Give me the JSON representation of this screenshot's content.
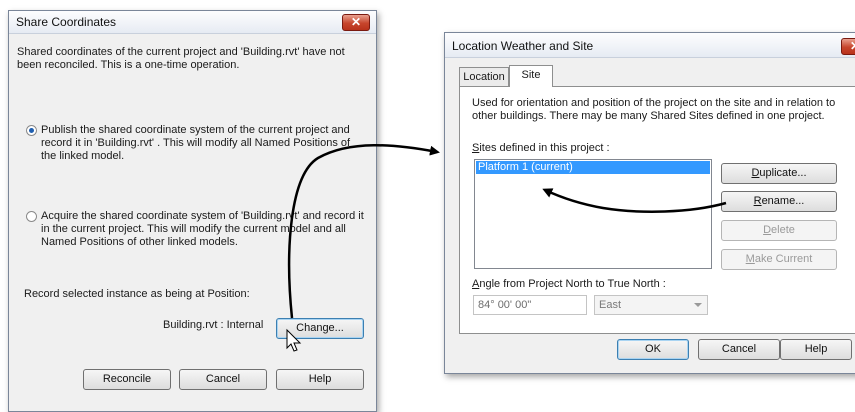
{
  "share_dialog": {
    "title": "Share Coordinates",
    "close_glyph": "✕",
    "intro": "Shared coordinates of the current project and 'Building.rvt' have not been reconciled. This is a one-time operation.",
    "option_publish": "Publish the shared coordinate system of the current project and record it in 'Building.rvt' . This will modify all Named Positions of the linked model.",
    "option_acquire": "Acquire the shared coordinate system of 'Building.rvt' and record it in the current project. This will modify the current model and all Named Positions of other linked models.",
    "selected_option": "publish",
    "record_label": "Record selected instance as being at Position:",
    "position_value": "Building.rvt : Internal",
    "change_button": "Change...",
    "reconcile_button": "Reconcile",
    "cancel_button": "Cancel",
    "help_button": "Help"
  },
  "location_dialog": {
    "title": "Location Weather and Site",
    "close_glyph": "✕",
    "tabs": [
      {
        "label": "Location",
        "active": false
      },
      {
        "label": "Site",
        "active": true
      }
    ],
    "description": "Used for orientation and position of the project on the site and in relation to other buildings. There may be many Shared Sites defined in one project.",
    "sites_label_prefix": "S",
    "sites_label_rest": "ites defined in this project :",
    "sites": [
      "Platform 1 (current)"
    ],
    "buttons": {
      "duplicate_prefix": "D",
      "duplicate_rest": "uplicate...",
      "rename_prefix": "R",
      "rename_rest": "ename...",
      "delete_prefix": "D",
      "delete_rest": "elete",
      "make_current_prefix": "M",
      "make_current_rest": "ake Current"
    },
    "angle_label_prefix": "A",
    "angle_label_rest": "ngle from Project North to True North :",
    "angle_value": "84° 00' 00\"",
    "direction_value": "East",
    "ok_button": "OK",
    "cancel_button": "Cancel",
    "help_button": "Help"
  },
  "colors": {
    "selection": "#3399ff",
    "close_button": "#c7452c",
    "arrow": "#000000"
  }
}
